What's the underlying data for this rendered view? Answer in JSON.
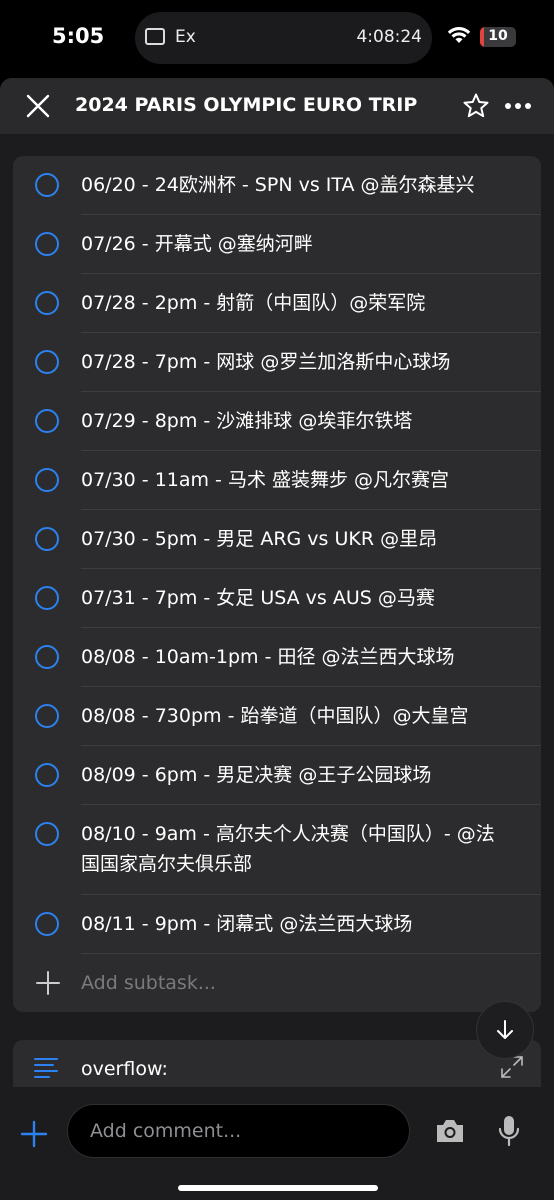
{
  "status_bar": {
    "time": "5:05",
    "island_label": "Ex",
    "island_timer": "4:08:24",
    "battery_level": "10",
    "battery_fraction": 0.1,
    "battery_color": "#e0443e"
  },
  "header": {
    "title": "2024 PARIS OLYMPIC EURO TRIP",
    "icons": [
      "close-icon",
      "star-icon",
      "more-icon"
    ]
  },
  "subtasks": [
    "06/20 - 24欧洲杯 - SPN vs ITA @盖尔森基兴",
    "07/26 - 开幕式 @塞纳河畔",
    "07/28 - 2pm - 射箭（中国队）@荣军院",
    "07/28 - 7pm - 网球 @罗兰加洛斯中心球场",
    "07/29 - 8pm - 沙滩排球 @埃菲尔铁塔",
    "07/30 - 11am - 马术 盛装舞步 @凡尔赛宫",
    "07/30 - 5pm - 男足 ARG vs UKR @里昂",
    "07/31 - 7pm - 女足 USA vs AUS @马赛",
    "08/08 - 10am-1pm - 田径 @法兰西大球场",
    "08/08 - 730pm - 跆拳道（中国队）@大皇宫",
    "08/09 - 6pm - 男足决赛 @王子公园球场",
    "08/10 - 9am - 高尔夫个人决赛（中国队）- @法国国家高尔夫俱乐部",
    "08/11 - 9pm - 闭幕式 @法兰西大球场"
  ],
  "add_subtask_label": "Add subtask...",
  "description": {
    "text": "overflow:"
  },
  "comment": {
    "placeholder": "Add comment..."
  },
  "colors": {
    "accent": "#2b82f0",
    "background": "#1c1c1e",
    "card": "#2c2c2e"
  }
}
